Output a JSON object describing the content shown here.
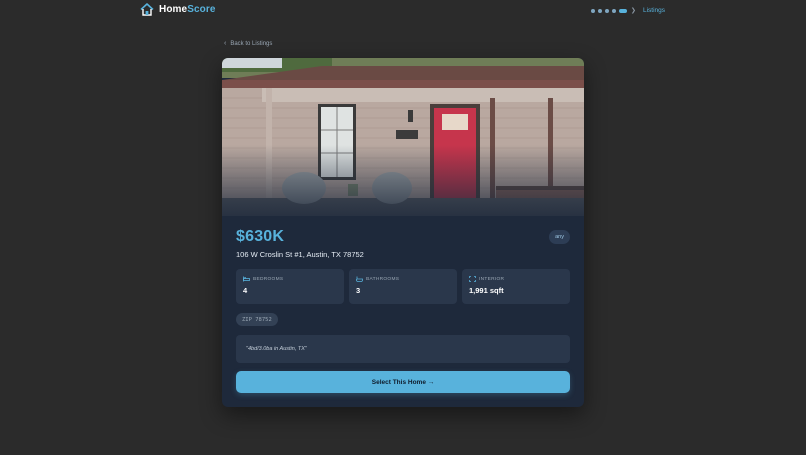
{
  "brand": {
    "name_primary": "Home",
    "name_accent": "Score",
    "accent_color": "#58b2dc"
  },
  "progress": {
    "steps_total": 5,
    "current_step": 5,
    "label": "Listings"
  },
  "nav": {
    "back_label": "Back to Listings"
  },
  "listing": {
    "price": "$630K",
    "address": "106 W Croslin St #1, Austin, TX 78752",
    "badge": "any",
    "stats": [
      {
        "icon": "bed-icon",
        "label": "BEDROOMS",
        "value": "4"
      },
      {
        "icon": "bath-icon",
        "label": "BATHROOMS",
        "value": "3"
      },
      {
        "icon": "expand-icon",
        "label": "INTERIOR",
        "value": "1,991 sqft"
      }
    ],
    "zip_tag": "ZIP 78752",
    "summary_quote": "\"4bd/3.0ba in Austin, TX\"",
    "photo_alt": "House front porch with red door"
  },
  "cta": {
    "label": "Select This Home →"
  }
}
